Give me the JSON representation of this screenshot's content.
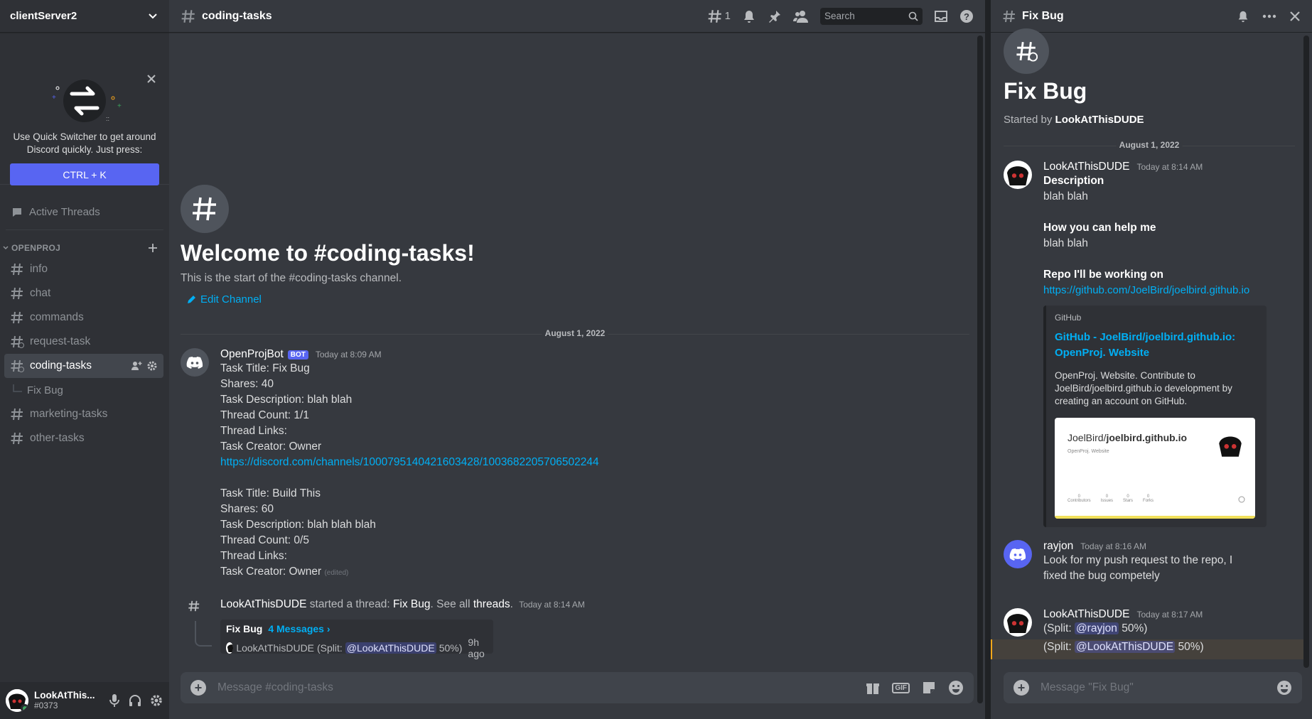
{
  "server": {
    "name": "clientServer2"
  },
  "quick_switcher": {
    "text": "Use Quick Switcher to get around Discord quickly. Just press:",
    "shortcut": "CTRL + K"
  },
  "active_threads": "Active Threads",
  "category": "OPENPROJ",
  "channels": [
    "info",
    "chat",
    "commands",
    "request-task",
    "coding-tasks",
    "marketing-tasks",
    "other-tasks"
  ],
  "subthread": "Fix Bug",
  "user": {
    "name": "LookAtThis...",
    "discriminator": "#0373"
  },
  "header": {
    "channel": "coding-tasks",
    "thread_count": "1",
    "search_placeholder": "Search"
  },
  "welcome": {
    "title": "Welcome to #coding-tasks!",
    "subtitle": "This is the start of the #coding-tasks channel.",
    "edit": "Edit Channel"
  },
  "date_divider": "August 1, 2022",
  "bot_message": {
    "author": "OpenProjBot",
    "tag": "BOT",
    "time": "Today at 8:09 AM",
    "lines": [
      "Task Title: Fix Bug",
      "Shares: 40",
      "Task Description: blah blah",
      "Thread Count: 1/1",
      "Thread Links:",
      "Task Creator: Owner"
    ],
    "link": "https://discord.com/channels/1000795140421603428/1003682205706502244",
    "lines2": [
      "Task Title: Build This",
      "Shares: 60",
      "Task Description: blah blah blah",
      "Thread Count: 0/5",
      "Thread Links:",
      "Task Creator: Owner"
    ],
    "edited": "(edited)"
  },
  "thread_start": {
    "author": "LookAtThisDUDE",
    "action": "started a thread:",
    "thread": "Fix Bug",
    "see_all": "See all",
    "threads": "threads",
    "time": "Today at 8:14 AM",
    "box_title": "Fix Bug",
    "box_count": "4 Messages ›",
    "preview_author": "LookAtThisDUDE",
    "preview_prefix": "(Split:",
    "preview_mention": "@LookAtThisDUDE",
    "preview_suffix": "50%)",
    "preview_time": "9h ago"
  },
  "composer": {
    "placeholder": "Message #coding-tasks"
  },
  "thread_panel": {
    "header": "Fix Bug",
    "title": "Fix Bug",
    "started_by": "Started by",
    "starter": "LookAtThisDUDE",
    "date": "August 1, 2022",
    "msg1": {
      "author": "LookAtThisDUDE",
      "time": "Today at 8:14 AM",
      "h1": "Description",
      "t1": "blah blah",
      "h2": "How you can help me",
      "t2": "blah blah",
      "h3": "Repo I'll be working on",
      "link": "https://github.com/JoelBird/joelbird.github.io",
      "embed_provider": "GitHub",
      "embed_title": "GitHub - JoelBird/joelbird.github.io: OpenProj. Website",
      "embed_desc": "OpenProj. Website. Contribute to JoelBird/joelbird.github.io development by creating an account on GitHub.",
      "card_owner": "JoelBird/",
      "card_repo": "joelbird.github.io",
      "card_desc": "OpenProj. Website",
      "card_stats": [
        "Contributors",
        "Issues",
        "Stars",
        "Forks"
      ],
      "card_count": "0"
    },
    "msg2": {
      "author": "rayjon",
      "time": "Today at 8:16 AM",
      "text": "Look for my push request to the repo, I fixed the bug competely"
    },
    "msg3": {
      "author": "LookAtThisDUDE",
      "time": "Today at 8:17 AM",
      "l1_prefix": "(Split:",
      "l1_mention": "@rayjon",
      "l1_suffix": "50%)",
      "l2_prefix": "(Split:",
      "l2_mention": "@LookAtThisDUDE",
      "l2_suffix": "50%)"
    },
    "composer_placeholder": "Message \"Fix Bug\""
  }
}
